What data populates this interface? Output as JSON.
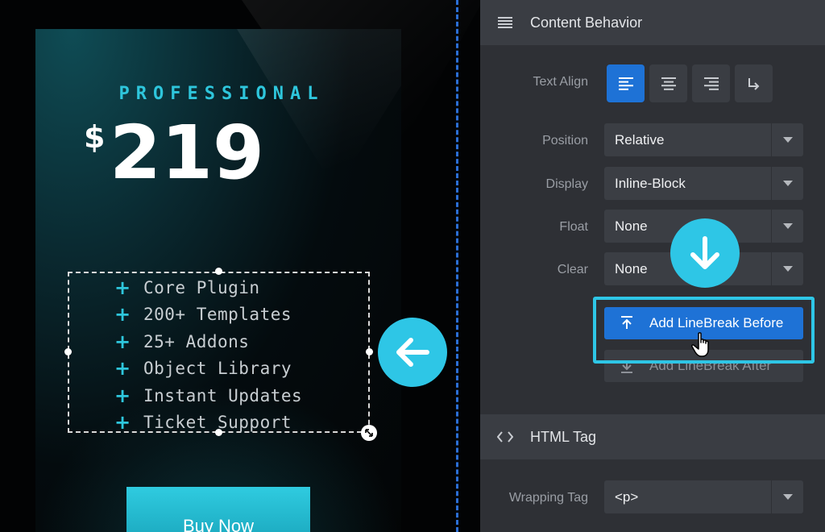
{
  "canvas": {
    "plan_name": "PROFESSIONAL",
    "price": {
      "currency": "$",
      "amount": "219"
    },
    "features": [
      "Core Plugin",
      "200+ Templates",
      "25+ Addons",
      "Object Library",
      "Instant Updates",
      "Ticket Support"
    ],
    "feature_bullet": "+",
    "buy_button": "Buy Now",
    "colors": {
      "accent": "#2ec6dc",
      "badge": "#2ec6e6",
      "divider": "#2b6fd6"
    }
  },
  "panel": {
    "content_behavior": {
      "header": "Content Behavior",
      "header_icon": "menu-lines-icon",
      "text_align": {
        "label": "Text Align",
        "options": [
          "align-left-icon",
          "align-center-icon",
          "align-right-icon",
          "linebreak-arrow-icon"
        ],
        "selected": "align-left-icon"
      },
      "position": {
        "label": "Position",
        "value": "Relative"
      },
      "display": {
        "label": "Display",
        "value": "Inline-Block"
      },
      "float": {
        "label": "Float",
        "value": "None"
      },
      "clear": {
        "label": "Clear",
        "value": "None"
      },
      "linebreak_before": "Add LineBreak Before",
      "linebreak_after": "Add LineBreak After"
    },
    "html_tag": {
      "header": "HTML Tag",
      "header_icon": "code-brackets-icon",
      "wrapping_tag": {
        "label": "Wrapping Tag",
        "value": "<p>"
      }
    },
    "colors": {
      "primary": "#1e72d6",
      "panel_bg": "#2e3035",
      "highlight": "#2ec6e6"
    }
  }
}
